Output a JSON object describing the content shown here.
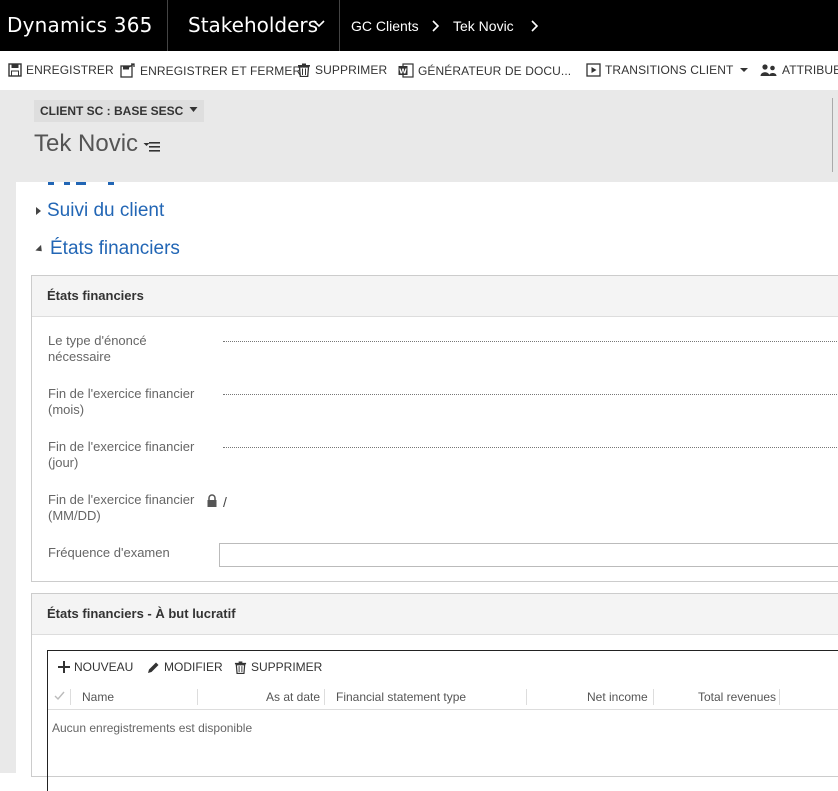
{
  "app": {
    "brand": "Dynamics 365",
    "area": "Stakeholders"
  },
  "breadcrumb": [
    "GC Clients",
    "Tek Novic"
  ],
  "commands": {
    "save": "ENREGISTRER",
    "save_close": "ENREGISTRER ET FERMER",
    "delete": "SUPPRIMER",
    "doc_generator": "GÉNÉRATEUR DE DOCU...",
    "transitions": "TRANSITIONS CLIENT",
    "assign": "ATTRIBUER"
  },
  "header": {
    "form_selector": "CLIENT SC : BASE SESC",
    "record_title": "Tek Novic"
  },
  "sections": {
    "tracking": "Suivi du client",
    "financial": "États financiers"
  },
  "financial_panel": {
    "title": "États financiers",
    "fields": [
      {
        "label": "Le type d'énoncé nécessaire"
      },
      {
        "label": "Fin de l'exercice financier (mois)"
      },
      {
        "label": "Fin de l'exercice financier (jour)"
      },
      {
        "label": "Fin de l'exercice financier (MM/DD)",
        "value": "/"
      },
      {
        "label": "Fréquence d'examen"
      }
    ]
  },
  "profit_panel": {
    "title": "États financiers - À but lucratif",
    "grid": {
      "commands": {
        "new": "NOUVEAU",
        "edit": "MODIFIER",
        "delete": "SUPPRIMER"
      },
      "columns": [
        "Name",
        "As at date",
        "Financial statement type",
        "Net income",
        "Total revenues"
      ],
      "empty_message": "Aucun enregistrements est disponible"
    }
  }
}
